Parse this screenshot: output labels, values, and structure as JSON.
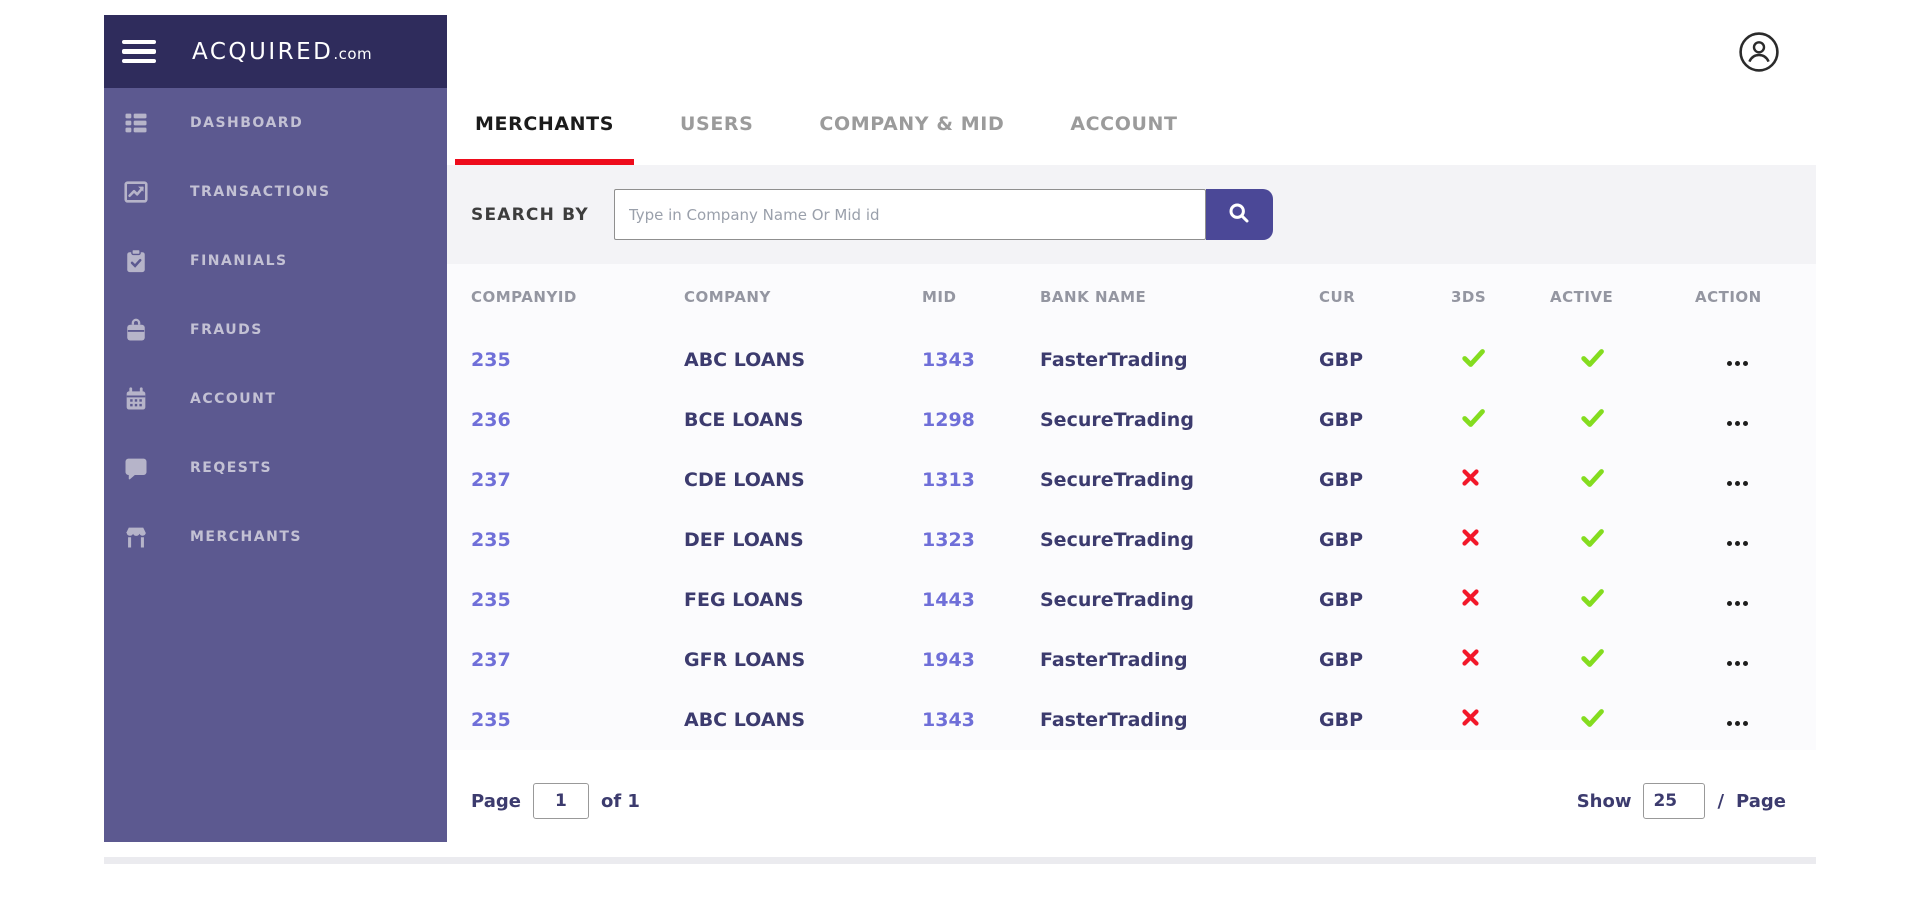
{
  "brand": {
    "name": "ACQUIRED",
    "suffix": ".com"
  },
  "sidebar": {
    "items": [
      {
        "label": "DASHBOARD",
        "icon": "dashboard-icon"
      },
      {
        "label": "TRANSACTIONS",
        "icon": "transactions-chart-icon"
      },
      {
        "label": "FINANIALS",
        "icon": "clipboard-check-icon"
      },
      {
        "label": "FRAUDS",
        "icon": "briefcase-icon"
      },
      {
        "label": "ACCOUNT",
        "icon": "calendar-icon"
      },
      {
        "label": "REQESTS",
        "icon": "chat-bubble-icon"
      },
      {
        "label": "MERCHANTS",
        "icon": "storefront-icon"
      }
    ]
  },
  "header": {
    "profile_icon": "user-profile-icon"
  },
  "tabs": [
    {
      "label": "MERCHANTS",
      "active": true
    },
    {
      "label": "USERS",
      "active": false
    },
    {
      "label": "COMPANY & MID",
      "active": false
    },
    {
      "label": "ACCOUNT",
      "active": false
    }
  ],
  "search": {
    "label": "SEARCH BY",
    "placeholder": "Type in Company Name Or Mid id",
    "button_icon": "search-icon"
  },
  "table": {
    "columns": [
      "COMPANYID",
      "COMPANY",
      "MID",
      "BANK NAME",
      "CUR",
      "3DS",
      "ACTIVE",
      "ACTION"
    ],
    "rows": [
      {
        "companyid": "235",
        "company": "ABC LOANS",
        "mid": "1343",
        "bank_name": "FasterTrading",
        "cur": "GBP",
        "tds": true,
        "active": true
      },
      {
        "companyid": "236",
        "company": "BCE LOANS",
        "mid": "1298",
        "bank_name": "SecureTrading",
        "cur": "GBP",
        "tds": true,
        "active": true
      },
      {
        "companyid": "237",
        "company": "CDE LOANS",
        "mid": "1313",
        "bank_name": "SecureTrading",
        "cur": "GBP",
        "tds": false,
        "active": true
      },
      {
        "companyid": "235",
        "company": "DEF LOANS",
        "mid": "1323",
        "bank_name": "SecureTrading",
        "cur": "GBP",
        "tds": false,
        "active": true
      },
      {
        "companyid": "235",
        "company": "FEG LOANS",
        "mid": "1443",
        "bank_name": "SecureTrading",
        "cur": "GBP",
        "tds": false,
        "active": true
      },
      {
        "companyid": "237",
        "company": "GFR LOANS",
        "mid": "1943",
        "bank_name": "FasterTrading",
        "cur": "GBP",
        "tds": false,
        "active": true
      },
      {
        "companyid": "235",
        "company": "ABC LOANS",
        "mid": "1343",
        "bank_name": "FasterTrading",
        "cur": "GBP",
        "tds": false,
        "active": true
      }
    ],
    "status_icons": {
      "true": "check-icon",
      "false": "cross-icon"
    },
    "action_icon": "ellipsis-icon"
  },
  "pagination": {
    "page_label": "Page",
    "page_value": "1",
    "of_label": "of 1",
    "show_label": "Show",
    "show_value": "25",
    "slash": "/",
    "per_page_label": "Page"
  },
  "colors": {
    "sidebar_header_bg": "#2f2c5c",
    "sidebar_bg": "#5c5990",
    "active_tab_underline": "#ee0c1c",
    "accent_indigo": "#4b4897",
    "link_indigo": "#6f6fd8",
    "dark_navy": "#3c3b6e",
    "success_green": "#84dc1f",
    "error_red": "#f2182a",
    "search_band_bg": "#f3f3f6"
  }
}
